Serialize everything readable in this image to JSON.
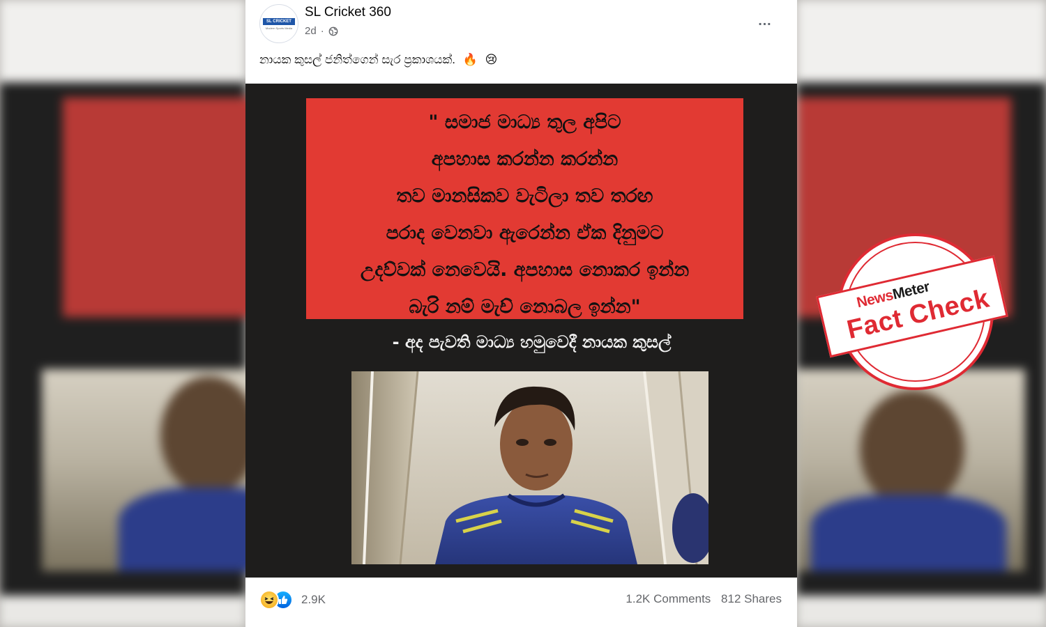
{
  "post": {
    "page_name": "SL Cricket 360",
    "time": "2d",
    "more_label": "…",
    "caption": "නායක කුසල් ජනිත්ගෙන් සැර ප්‍රකාශයක්.",
    "caption_emoji_1": "🔥",
    "caption_emoji_2": "😢",
    "avatar_text": "SL CRICKET 360",
    "avatar_subtext": "Modern Sports Media"
  },
  "image": {
    "quote_lines": [
      "\" සමාජ මාධ්‍ය තුල අපිට",
      "අපහාස කරන්න කරන්න",
      "තව මානසිකව වැටිලා තව තරඟ",
      "පරාද වෙනවා ඇරෙන්න ඒක දිනුමට",
      "උදව්වක් නෙවෙයි. අපහාස නොකර ඉන්න",
      "බැරි නම් මැච් නොබල ඉන්න\""
    ],
    "attribution": "- අද පැවති මාධ්‍ය හමුවෙදී නායක කුසල්"
  },
  "footer": {
    "reaction_count": "2.9K",
    "comments": "1.2K Comments",
    "shares": "812 Shares"
  },
  "stamp": {
    "brand_news": "News",
    "brand_meter": "Meter",
    "label": "Fact Check"
  },
  "colors": {
    "quote_red": "#e23a33",
    "stamp_red": "#df2a33",
    "image_bg": "#1e1d1c"
  }
}
